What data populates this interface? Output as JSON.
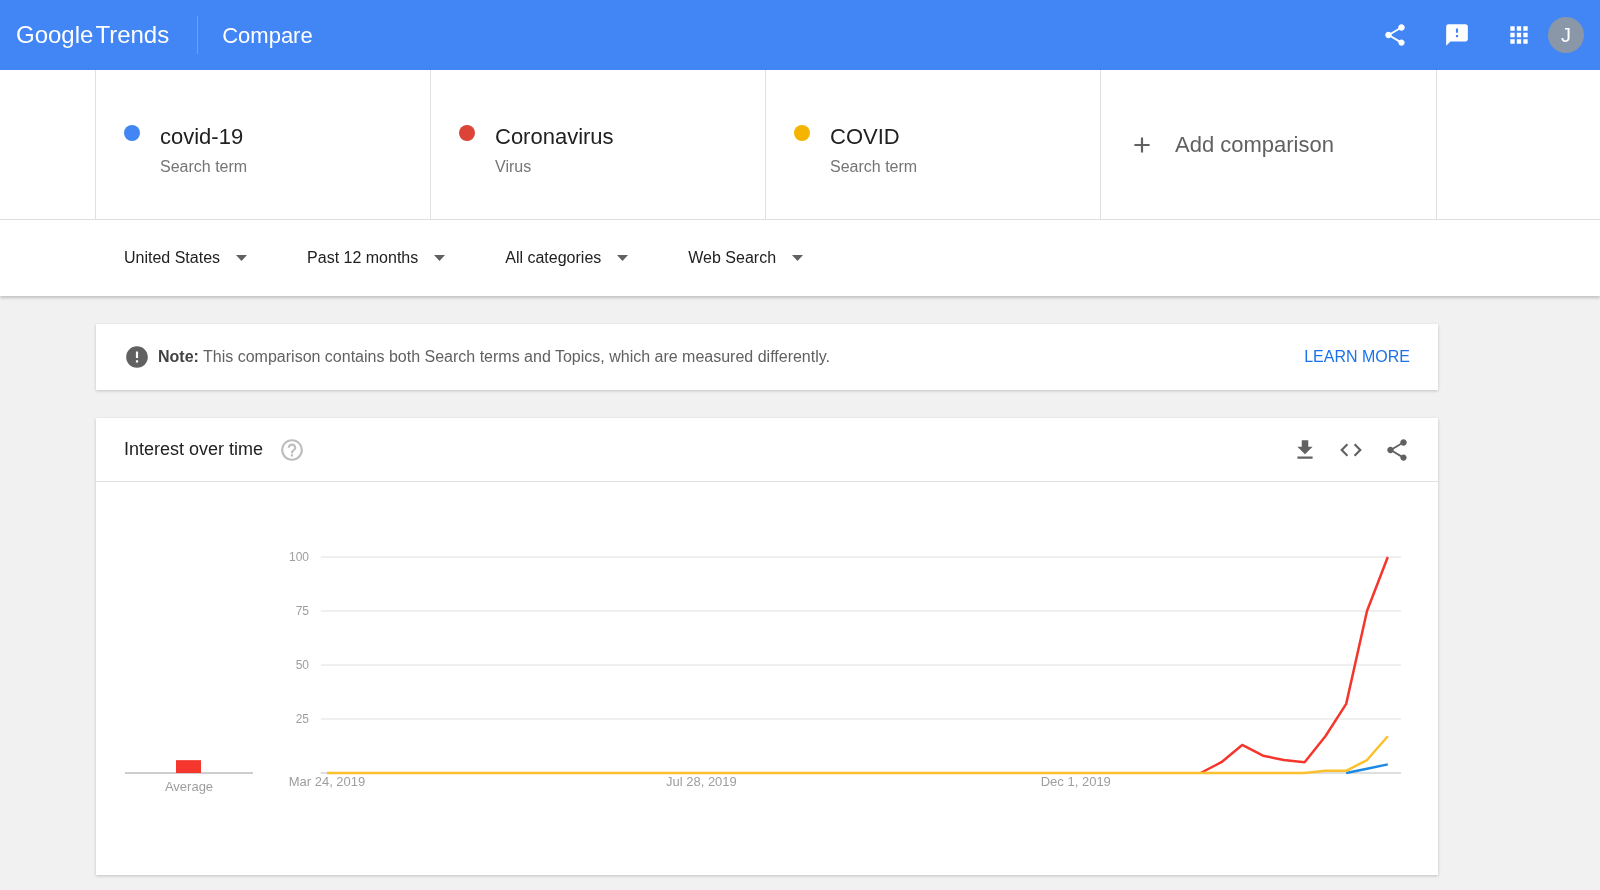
{
  "header": {
    "logo_brand": "Google",
    "logo_product": "Trends",
    "title": "Compare",
    "avatar": "J"
  },
  "terms": [
    {
      "name": "covid-19",
      "type": "Search term",
      "color": "#4285f4"
    },
    {
      "name": "Coronavirus",
      "type": "Virus",
      "color": "#db4437"
    },
    {
      "name": "COVID",
      "type": "Search term",
      "color": "#f4b400"
    }
  ],
  "add_comparison": "Add comparison",
  "filters": [
    "United States",
    "Past 12 months",
    "All categories",
    "Web Search"
  ],
  "note": {
    "text": "**Note:** This comparison contains both Search terms and Topics, which are measured differently.",
    "link": "LEARN MORE"
  },
  "interest_over_time": {
    "title": "Interest over time",
    "average_label": "Average",
    "chart_data": {
      "type": "line",
      "grid": true,
      "ylim": [
        0,
        100
      ],
      "yticks": [
        25,
        50,
        75,
        100
      ],
      "categories": [
        "Mar 24, 2019",
        null,
        null,
        null,
        null,
        null,
        null,
        null,
        null,
        null,
        null,
        null,
        null,
        null,
        null,
        null,
        null,
        null,
        "Jul 28, 2019",
        null,
        null,
        null,
        null,
        null,
        null,
        null,
        null,
        null,
        null,
        null,
        null,
        null,
        null,
        null,
        null,
        null,
        "Dec 1, 2019",
        null,
        null,
        null,
        null,
        null,
        null,
        null,
        null,
        null,
        null,
        null,
        null,
        null,
        null,
        null
      ],
      "series": [
        {
          "color": "#1e88e5",
          "values": [
            null,
            null,
            null,
            null,
            null,
            null,
            null,
            null,
            null,
            null,
            null,
            null,
            null,
            null,
            null,
            null,
            null,
            null,
            null,
            null,
            null,
            null,
            null,
            null,
            null,
            null,
            null,
            null,
            null,
            null,
            null,
            null,
            null,
            null,
            null,
            null,
            null,
            null,
            null,
            null,
            null,
            null,
            null,
            null,
            null,
            null,
            null,
            null,
            null,
            0,
            2,
            4
          ]
        },
        {
          "color": "#f4362c",
          "values": [
            null,
            null,
            null,
            null,
            null,
            null,
            null,
            null,
            null,
            null,
            null,
            null,
            null,
            null,
            null,
            null,
            null,
            null,
            null,
            null,
            null,
            null,
            null,
            null,
            null,
            null,
            null,
            null,
            null,
            null,
            null,
            null,
            null,
            null,
            null,
            null,
            null,
            null,
            null,
            null,
            null,
            null,
            0,
            5,
            13,
            8,
            6,
            5,
            17,
            32,
            75,
            100
          ]
        },
        {
          "color": "#fbc02d",
          "values": [
            0,
            0,
            0,
            0,
            0,
            0,
            0,
            0,
            0,
            0,
            0,
            0,
            0,
            0,
            0,
            0,
            0,
            0,
            0,
            0,
            0,
            0,
            0,
            0,
            0,
            0,
            0,
            0,
            0,
            0,
            0,
            0,
            0,
            0,
            0,
            0,
            0,
            0,
            0,
            0,
            0,
            0,
            0,
            0,
            0,
            0,
            0,
            0,
            1,
            1,
            6,
            17
          ]
        }
      ]
    }
  }
}
